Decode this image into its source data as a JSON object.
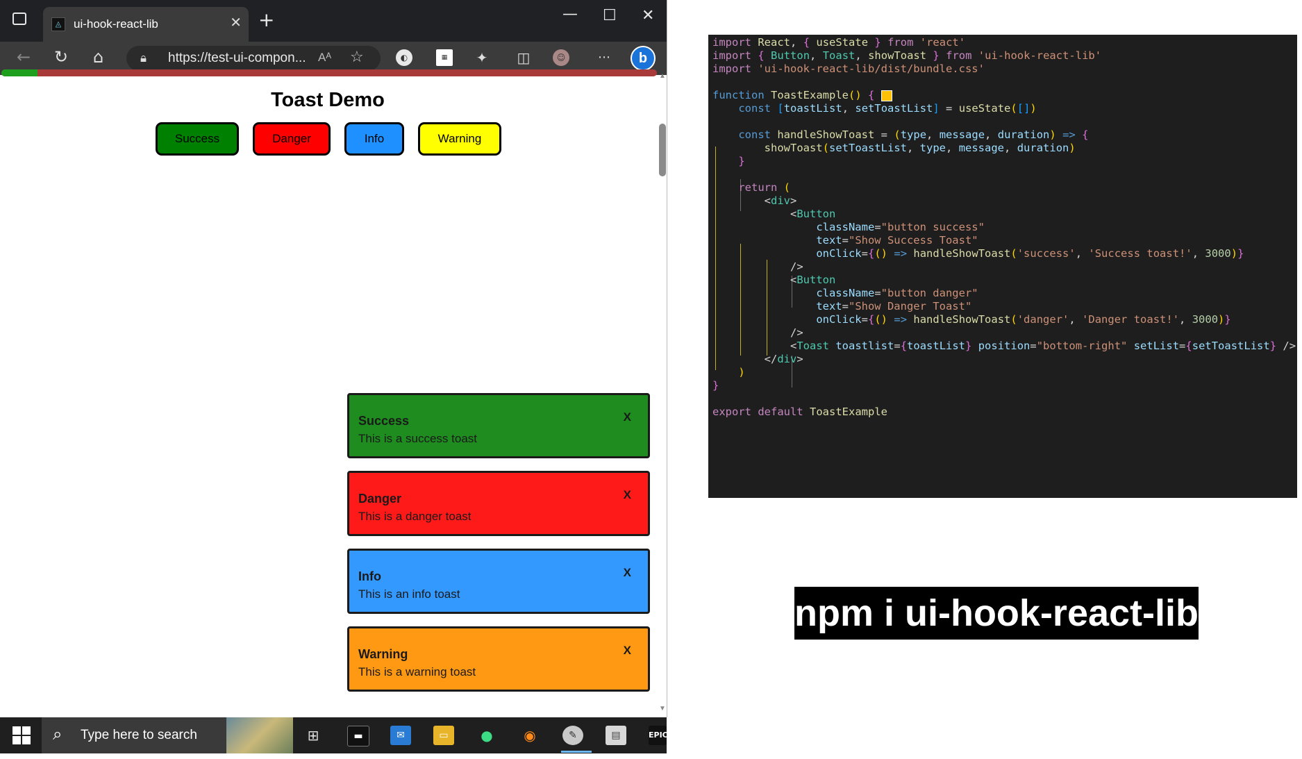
{
  "browser": {
    "tab_title": "ui-hook-react-lib",
    "tab_close": "✕",
    "new_tab": "+",
    "window_min": "—",
    "window_max": "☐",
    "window_close": "✕",
    "url": "https://test-ui-compon...",
    "read_aloud": "A̅⁾",
    "load_progress": 0.055,
    "load_colors": {
      "fill": "#1ea01e",
      "track": "#a83a3a"
    }
  },
  "page": {
    "title": "Toast Demo",
    "buttons": [
      {
        "label": "Success",
        "color": "#008000"
      },
      {
        "label": "Danger",
        "color": "#ff0000"
      },
      {
        "label": "Info",
        "color": "#1e90ff"
      },
      {
        "label": "Warning",
        "color": "#ffff00"
      }
    ],
    "toasts": [
      {
        "title": "Success",
        "message": "This is a success toast",
        "close": "X",
        "color": "#1e8c1e"
      },
      {
        "title": "Danger",
        "message": "This is a danger toast",
        "close": "X",
        "color": "#ff1a1a"
      },
      {
        "title": "Info",
        "message": "This is an info toast",
        "close": "X",
        "color": "#3399ff"
      },
      {
        "title": "Warning",
        "message": "This is a warning toast",
        "close": "X",
        "color": "#ff9914"
      }
    ]
  },
  "taskbar": {
    "search_placeholder": "Type here to search",
    "epic_label": "EPIC"
  },
  "code": {
    "lines": [
      "import React, { useState } from 'react'",
      "import { Button, Toast, showToast } from 'ui-hook-react-lib'",
      "import 'ui-hook-react-lib/dist/bundle.css'",
      "",
      "function ToastExample() {",
      "    const [toastList, setToastList] = useState([])",
      "",
      "    const handleShowToast = (type, message, duration) => {",
      "        showToast(setToastList, type, message, duration)",
      "    }",
      "",
      "    return (",
      "        <div>",
      "            <Button",
      "                className=\"button success\"",
      "                text=\"Show Success Toast\"",
      "                onClick={() => handleShowToast('success', 'Success toast!', 3000)}",
      "            />",
      "            <Button",
      "                className=\"button danger\"",
      "                text=\"Show Danger Toast\"",
      "                onClick={() => handleShowToast('danger', 'Danger toast!', 3000)}",
      "            />",
      "            <Toast toastlist={toastList} position=\"bottom-right\" setList={setToastList} />",
      "        </div>",
      "    )",
      "}",
      "",
      "export default ToastExample"
    ]
  },
  "npm_command": "npm i ui-hook-react-lib"
}
